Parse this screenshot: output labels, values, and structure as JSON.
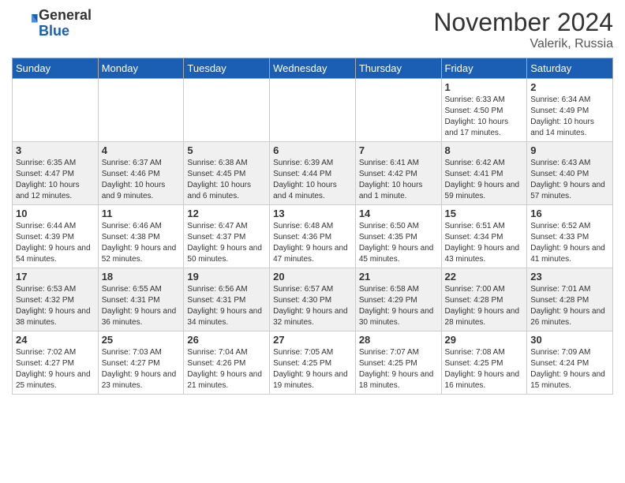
{
  "header": {
    "logo_line1": "General",
    "logo_line2": "Blue",
    "month": "November 2024",
    "location": "Valerik, Russia"
  },
  "weekdays": [
    "Sunday",
    "Monday",
    "Tuesday",
    "Wednesday",
    "Thursday",
    "Friday",
    "Saturday"
  ],
  "rows": [
    [
      {
        "day": "",
        "info": ""
      },
      {
        "day": "",
        "info": ""
      },
      {
        "day": "",
        "info": ""
      },
      {
        "day": "",
        "info": ""
      },
      {
        "day": "",
        "info": ""
      },
      {
        "day": "1",
        "info": "Sunrise: 6:33 AM\nSunset: 4:50 PM\nDaylight: 10 hours and 17 minutes."
      },
      {
        "day": "2",
        "info": "Sunrise: 6:34 AM\nSunset: 4:49 PM\nDaylight: 10 hours and 14 minutes."
      }
    ],
    [
      {
        "day": "3",
        "info": "Sunrise: 6:35 AM\nSunset: 4:47 PM\nDaylight: 10 hours and 12 minutes."
      },
      {
        "day": "4",
        "info": "Sunrise: 6:37 AM\nSunset: 4:46 PM\nDaylight: 10 hours and 9 minutes."
      },
      {
        "day": "5",
        "info": "Sunrise: 6:38 AM\nSunset: 4:45 PM\nDaylight: 10 hours and 6 minutes."
      },
      {
        "day": "6",
        "info": "Sunrise: 6:39 AM\nSunset: 4:44 PM\nDaylight: 10 hours and 4 minutes."
      },
      {
        "day": "7",
        "info": "Sunrise: 6:41 AM\nSunset: 4:42 PM\nDaylight: 10 hours and 1 minute."
      },
      {
        "day": "8",
        "info": "Sunrise: 6:42 AM\nSunset: 4:41 PM\nDaylight: 9 hours and 59 minutes."
      },
      {
        "day": "9",
        "info": "Sunrise: 6:43 AM\nSunset: 4:40 PM\nDaylight: 9 hours and 57 minutes."
      }
    ],
    [
      {
        "day": "10",
        "info": "Sunrise: 6:44 AM\nSunset: 4:39 PM\nDaylight: 9 hours and 54 minutes."
      },
      {
        "day": "11",
        "info": "Sunrise: 6:46 AM\nSunset: 4:38 PM\nDaylight: 9 hours and 52 minutes."
      },
      {
        "day": "12",
        "info": "Sunrise: 6:47 AM\nSunset: 4:37 PM\nDaylight: 9 hours and 50 minutes."
      },
      {
        "day": "13",
        "info": "Sunrise: 6:48 AM\nSunset: 4:36 PM\nDaylight: 9 hours and 47 minutes."
      },
      {
        "day": "14",
        "info": "Sunrise: 6:50 AM\nSunset: 4:35 PM\nDaylight: 9 hours and 45 minutes."
      },
      {
        "day": "15",
        "info": "Sunrise: 6:51 AM\nSunset: 4:34 PM\nDaylight: 9 hours and 43 minutes."
      },
      {
        "day": "16",
        "info": "Sunrise: 6:52 AM\nSunset: 4:33 PM\nDaylight: 9 hours and 41 minutes."
      }
    ],
    [
      {
        "day": "17",
        "info": "Sunrise: 6:53 AM\nSunset: 4:32 PM\nDaylight: 9 hours and 38 minutes."
      },
      {
        "day": "18",
        "info": "Sunrise: 6:55 AM\nSunset: 4:31 PM\nDaylight: 9 hours and 36 minutes."
      },
      {
        "day": "19",
        "info": "Sunrise: 6:56 AM\nSunset: 4:31 PM\nDaylight: 9 hours and 34 minutes."
      },
      {
        "day": "20",
        "info": "Sunrise: 6:57 AM\nSunset: 4:30 PM\nDaylight: 9 hours and 32 minutes."
      },
      {
        "day": "21",
        "info": "Sunrise: 6:58 AM\nSunset: 4:29 PM\nDaylight: 9 hours and 30 minutes."
      },
      {
        "day": "22",
        "info": "Sunrise: 7:00 AM\nSunset: 4:28 PM\nDaylight: 9 hours and 28 minutes."
      },
      {
        "day": "23",
        "info": "Sunrise: 7:01 AM\nSunset: 4:28 PM\nDaylight: 9 hours and 26 minutes."
      }
    ],
    [
      {
        "day": "24",
        "info": "Sunrise: 7:02 AM\nSunset: 4:27 PM\nDaylight: 9 hours and 25 minutes."
      },
      {
        "day": "25",
        "info": "Sunrise: 7:03 AM\nSunset: 4:27 PM\nDaylight: 9 hours and 23 minutes."
      },
      {
        "day": "26",
        "info": "Sunrise: 7:04 AM\nSunset: 4:26 PM\nDaylight: 9 hours and 21 minutes."
      },
      {
        "day": "27",
        "info": "Sunrise: 7:05 AM\nSunset: 4:25 PM\nDaylight: 9 hours and 19 minutes."
      },
      {
        "day": "28",
        "info": "Sunrise: 7:07 AM\nSunset: 4:25 PM\nDaylight: 9 hours and 18 minutes."
      },
      {
        "day": "29",
        "info": "Sunrise: 7:08 AM\nSunset: 4:25 PM\nDaylight: 9 hours and 16 minutes."
      },
      {
        "day": "30",
        "info": "Sunrise: 7:09 AM\nSunset: 4:24 PM\nDaylight: 9 hours and 15 minutes."
      }
    ]
  ]
}
